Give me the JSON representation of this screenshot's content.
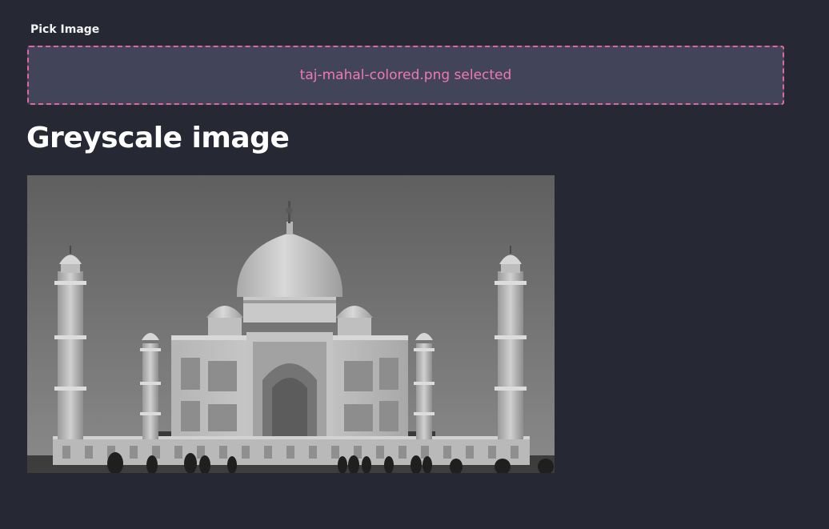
{
  "picker": {
    "label": "Pick Image",
    "selected_text": "taj-mahal-colored.png selected"
  },
  "result": {
    "heading": "Greyscale image"
  },
  "colors": {
    "background": "#262833",
    "dropzone_bg": "#424459",
    "accent": "#e2679c",
    "accent_text": "#ef79b0"
  }
}
